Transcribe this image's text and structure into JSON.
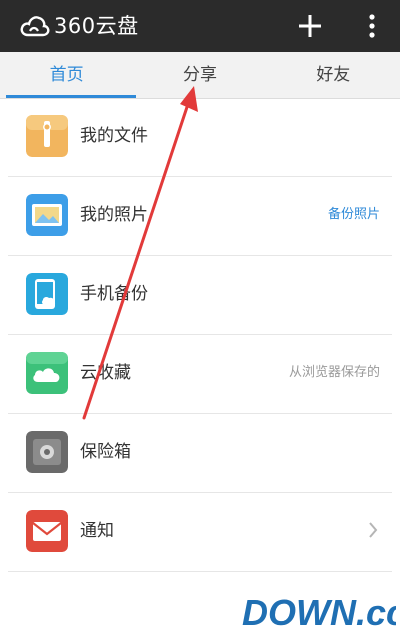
{
  "header": {
    "title": "360云盘",
    "plus_icon": "plus-icon",
    "more_icon": "more-vertical-icon"
  },
  "tabs": [
    {
      "label": "首页",
      "active": true
    },
    {
      "label": "分享",
      "active": false
    },
    {
      "label": "好友",
      "active": false
    }
  ],
  "list": [
    {
      "label": "我的文件",
      "right": "",
      "icon": "folder-icon"
    },
    {
      "label": "我的照片",
      "right": "备份照片",
      "icon": "photo-icon"
    },
    {
      "label": "手机备份",
      "right": "",
      "icon": "phone-backup-icon"
    },
    {
      "label": "云收藏",
      "right": "从浏览器保存的",
      "icon": "cloud-icon"
    },
    {
      "label": "保险箱",
      "right": "",
      "icon": "safe-icon"
    },
    {
      "label": "通知",
      "right": "",
      "icon": "mail-icon"
    }
  ],
  "watermark": {
    "text": "DOWN.cc"
  },
  "colors": {
    "topbar": "#2b2b2b",
    "accent": "#2f8ad8",
    "arrow": "#e23a3a"
  }
}
